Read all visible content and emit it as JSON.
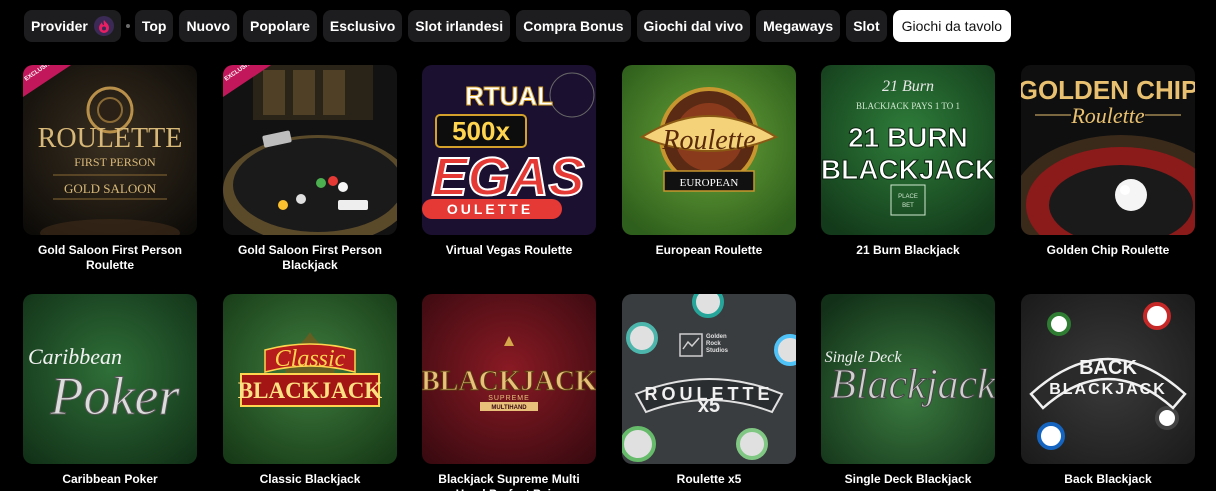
{
  "filters": {
    "provider_label": "Provider",
    "tabs": [
      "Top",
      "Nuovo",
      "Popolare",
      "Esclusivo",
      "Slot irlandesi",
      "Compra Bonus",
      "Giochi dal vivo",
      "Megaways",
      "Slot",
      "Giochi da tavolo"
    ],
    "active_tab": "Giochi da tavolo"
  },
  "badges": {
    "exclusive": "EXCLUSIVE"
  },
  "art": {
    "roulette_fp": {
      "l1": "ROULETTE",
      "l2": "FIRST PERSON",
      "l3": "GOLD SALOON"
    },
    "vegas": {
      "l1": "RTUAL",
      "l2": "500x",
      "l3": "EGAS",
      "l4": "OULETTE"
    },
    "european": {
      "l1": "Roulette",
      "l2": "EUROPEAN"
    },
    "burn": {
      "l1": "21 Burn",
      "l2": "BLACKJACK PAYS 1 TO 1",
      "l3": "21 BURN",
      "l4": "BLACKJACK",
      "l5": "PLACE",
      "l6": "BET"
    },
    "golden_chip": {
      "l1": "GOLDEN CHIP",
      "l2": "Roulette"
    },
    "caribbean": {
      "l1": "Caribbean",
      "l2": "Poker"
    },
    "classic": {
      "l1": "Classic",
      "l2": "BLACKJACK"
    },
    "supreme": {
      "l1": "BLACKJACK",
      "l2": "SUPREME",
      "l3": "MULTIHAND"
    },
    "x5": {
      "l1": "Golden",
      "l2": "Rock",
      "l3": "Studios",
      "l4": "ROULETTE",
      "l5": "x5"
    },
    "single_deck": {
      "l1": "Single Deck",
      "l2": "Blackjack"
    },
    "back": {
      "l1": "BACK",
      "l2": "BLACKJACK"
    }
  },
  "games": [
    {
      "title": "Gold Saloon First Person Roulette"
    },
    {
      "title": "Gold Saloon First Person Blackjack"
    },
    {
      "title": "Virtual Vegas Roulette"
    },
    {
      "title": "European Roulette"
    },
    {
      "title": "21 Burn Blackjack"
    },
    {
      "title": "Golden Chip Roulette"
    },
    {
      "title": "Caribbean Poker"
    },
    {
      "title": "Classic Blackjack"
    },
    {
      "title": "Blackjack Supreme Multi Hand Perfect Pairs"
    },
    {
      "title": "Roulette x5"
    },
    {
      "title": "Single Deck Blackjack"
    },
    {
      "title": "Back Blackjack"
    }
  ],
  "colors": {
    "chip_bg": "#1d1d1f",
    "active_chip_bg": "#ffffff",
    "exclusive_ribbon": "#c2185b",
    "provider_icon": "#e91e63"
  }
}
